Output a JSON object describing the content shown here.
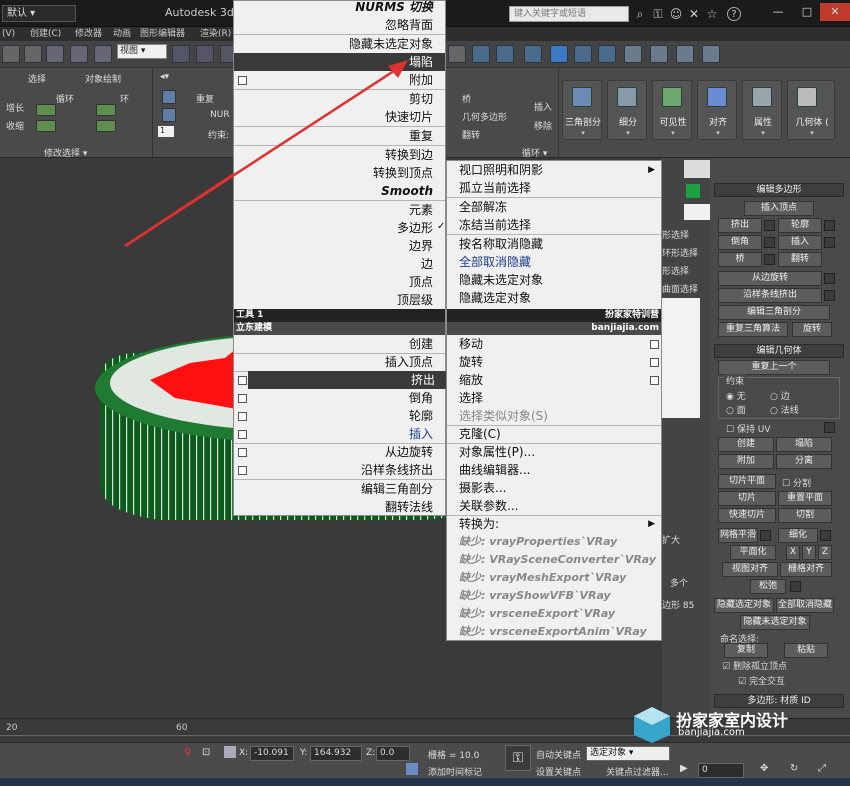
{
  "titlebar": {
    "workspace": "默认",
    "app_title": "Autodesk 3ds M",
    "search_placeholder": "键入关键字或短语",
    "help": "?"
  },
  "menubar": [
    "(V)",
    "创建(C)",
    "修改器",
    "动画",
    "图形编辑器",
    "渲染(R)"
  ],
  "toolbar": {
    "view_dropdown": "视图"
  },
  "ribbon": {
    "tabs_row": [
      "选择",
      "对象绘制"
    ],
    "left_labels": [
      "增长",
      "收缩",
      "循环",
      "环"
    ],
    "modify_selection": "修改选择",
    "mid_labels": [
      "重复",
      "NUR",
      "约束:"
    ],
    "count_value": "1",
    "right_labels": [
      "桥",
      "几何多边形",
      "翻转",
      "插入",
      "移除"
    ],
    "loop_label": "循环",
    "buttons": [
      "三角剖分",
      "细分",
      "可见性",
      "对齐",
      "属性",
      "几何体 ("
    ]
  },
  "quad_left": {
    "top_items": [
      "NURMS 切换",
      "忽略背面",
      "隐藏未选定对象",
      "塌陷",
      "附加",
      "剪切",
      "快速切片",
      "重复",
      "转换到边",
      "转换到顶点",
      "Smooth",
      "元素",
      "多边形",
      "边界",
      "边",
      "顶点",
      "顶层级"
    ],
    "header_title": "工具 1",
    "header_sub": "立东建模",
    "bottom_items": [
      "创建",
      "插入顶点",
      "挤出",
      "倒角",
      "轮廓",
      "插入",
      "从边旋转",
      "沿样条线挤出",
      "编辑三角剖分",
      "翻转法线"
    ]
  },
  "quad_right": {
    "top_items": [
      "视口照明和阴影",
      "孤立当前选择",
      "全部解冻",
      "冻结当前选择",
      "按名称取消隐藏",
      "全部取消隐藏",
      "隐藏未选定对象",
      "隐藏选定对象"
    ],
    "header_title": "扮家家特训营",
    "header_sub": "banjiajia.com",
    "bottom_items": [
      "移动",
      "旋转",
      "缩放",
      "选择",
      "选择类似对象(S)",
      "克隆(C)",
      "对象属性(P)...",
      "曲线编辑器...",
      "摄影表...",
      "关联参数...",
      "转换为:",
      "缺少: vrayProperties`VRay",
      "缺少: VRaySceneConverter`VRay",
      "缺少: vrayMeshExport`VRay",
      "缺少: vrayShowVFB`VRay",
      "缺少: vrsceneExport`VRay",
      "缺少: vrsceneExportAnim`VRay"
    ]
  },
  "mid_strip": [
    "形选择",
    "环形选择",
    "形选择",
    "曲面选择",
    "扩大",
    "多个",
    "边形 85"
  ],
  "command_panel": {
    "edit_poly_title": "编辑多边形",
    "insert_vertex": "插入顶点",
    "extrude": "挤出",
    "outline": "轮廓",
    "bevel": "倒角",
    "inset": "插入",
    "bridge": "桥",
    "flip": "翻转",
    "hinge": "从边旋转",
    "extrude_spline": "沿样条线挤出",
    "edit_tri": "编辑三角剖分",
    "retri": "重复三角算法",
    "turn": "旋转",
    "edit_geo_title": "编辑几何体",
    "repeat_last": "重复上一个",
    "constraint": "约束",
    "c_none": "无",
    "c_edge": "边",
    "c_face": "面",
    "c_normal": "法线",
    "preserve_uv": "保持 UV",
    "create": "创建",
    "collapse": "塌陷",
    "attach": "附加",
    "detach": "分离",
    "slice_plane": "切片平面",
    "split": "分割",
    "slice": "切片",
    "reset_plane": "重置平面",
    "quickslice": "快速切片",
    "cut": "切割",
    "meshsmooth": "网格平滑",
    "tessellate": "细化",
    "planarize": "平面化",
    "x": "X",
    "y": "Y",
    "z": "Z",
    "view_align": "视图对齐",
    "grid_align": "栅格对齐",
    "relax": "松弛",
    "hide_sel": "隐藏选定对象",
    "unhide_all": "全部取消隐藏",
    "hide_unsel": "隐藏未选定对象",
    "named_sel": "命名选择:",
    "copy": "复制",
    "paste": "粘贴",
    "del_iso": "删除孤立顶点",
    "full_interop": "完全交互",
    "mat_id": "多边形: 材质 ID"
  },
  "timeline": {
    "tick": "20",
    "tick2": "60"
  },
  "statusbar": {
    "x_label": "X:",
    "x_value": "-10.091",
    "y_label": "Y:",
    "y_value": "164.932",
    "z_label": "Z:",
    "z_value": "0.0",
    "grid": "栅格 = 10.0",
    "auto_key": "自动关键点",
    "set_key": "设置关键点",
    "selected": "选定对象",
    "key_filters": "关键点过滤器...",
    "add_time_tag": "添加时间标记",
    "frame": "0"
  },
  "watermark": {
    "name": "扮家家室内设计",
    "url": "banjiajia.com"
  }
}
